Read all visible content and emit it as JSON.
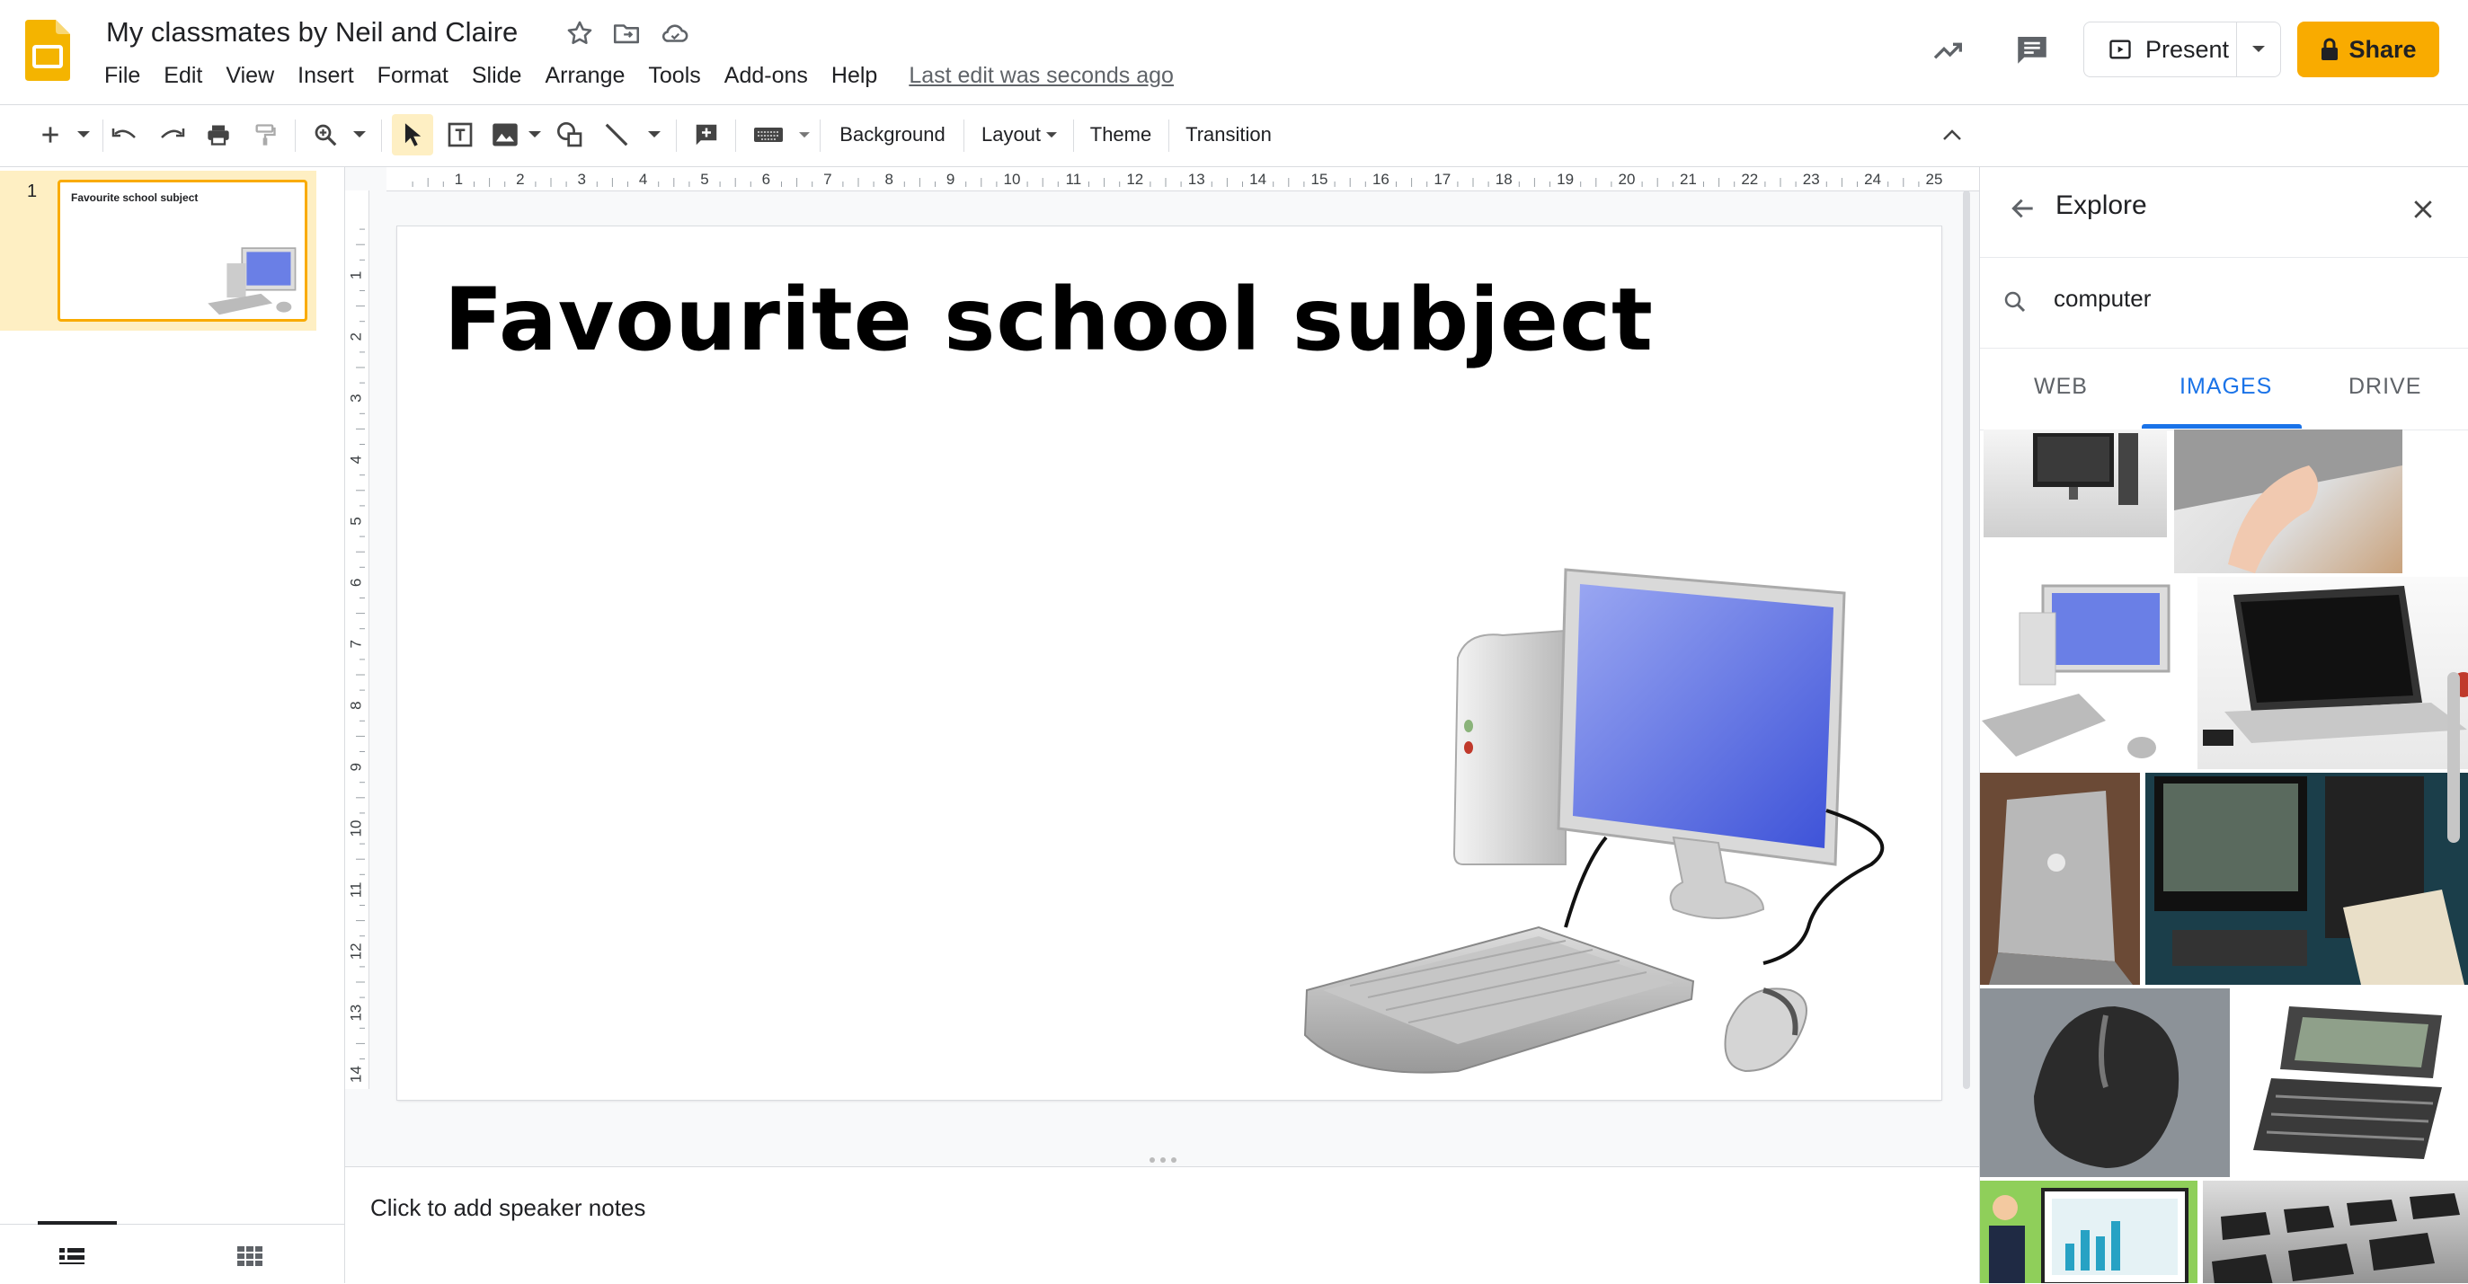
{
  "document": {
    "title": "My classmates by Neil and Claire",
    "last_edit": "Last edit was seconds ago"
  },
  "menu": [
    "File",
    "Edit",
    "View",
    "Insert",
    "Format",
    "Slide",
    "Arrange",
    "Tools",
    "Add-ons",
    "Help"
  ],
  "header_actions": {
    "present_label": "Present",
    "share_label": "Share"
  },
  "toolbar": {
    "background_label": "Background",
    "layout_label": "Layout",
    "theme_label": "Theme",
    "transition_label": "Transition"
  },
  "ruler": {
    "horizontal": [
      "1",
      "2",
      "3",
      "4",
      "5",
      "6",
      "7",
      "8",
      "9",
      "10",
      "11",
      "12",
      "13",
      "14",
      "15",
      "16",
      "17",
      "18",
      "19",
      "20",
      "21",
      "22",
      "23",
      "24",
      "25"
    ],
    "vertical": [
      "1",
      "2",
      "3",
      "4",
      "5",
      "6",
      "7",
      "8",
      "9",
      "10",
      "11",
      "12",
      "13",
      "14"
    ]
  },
  "filmstrip": {
    "slides": [
      {
        "number": "1",
        "title": "Favourite school subject"
      }
    ]
  },
  "slide": {
    "title": "Favourite school subject"
  },
  "notes": {
    "placeholder": "Click to add speaker notes"
  },
  "explore": {
    "title": "Explore",
    "search_value": "computer",
    "tabs": [
      "WEB",
      "IMAGES",
      "DRIVE"
    ],
    "active_tab": "IMAGES"
  },
  "colors": {
    "accent": "#1a73e8",
    "share": "#f9ab00",
    "selection": "#feefc3",
    "slides_yellow": "#f4b400"
  }
}
